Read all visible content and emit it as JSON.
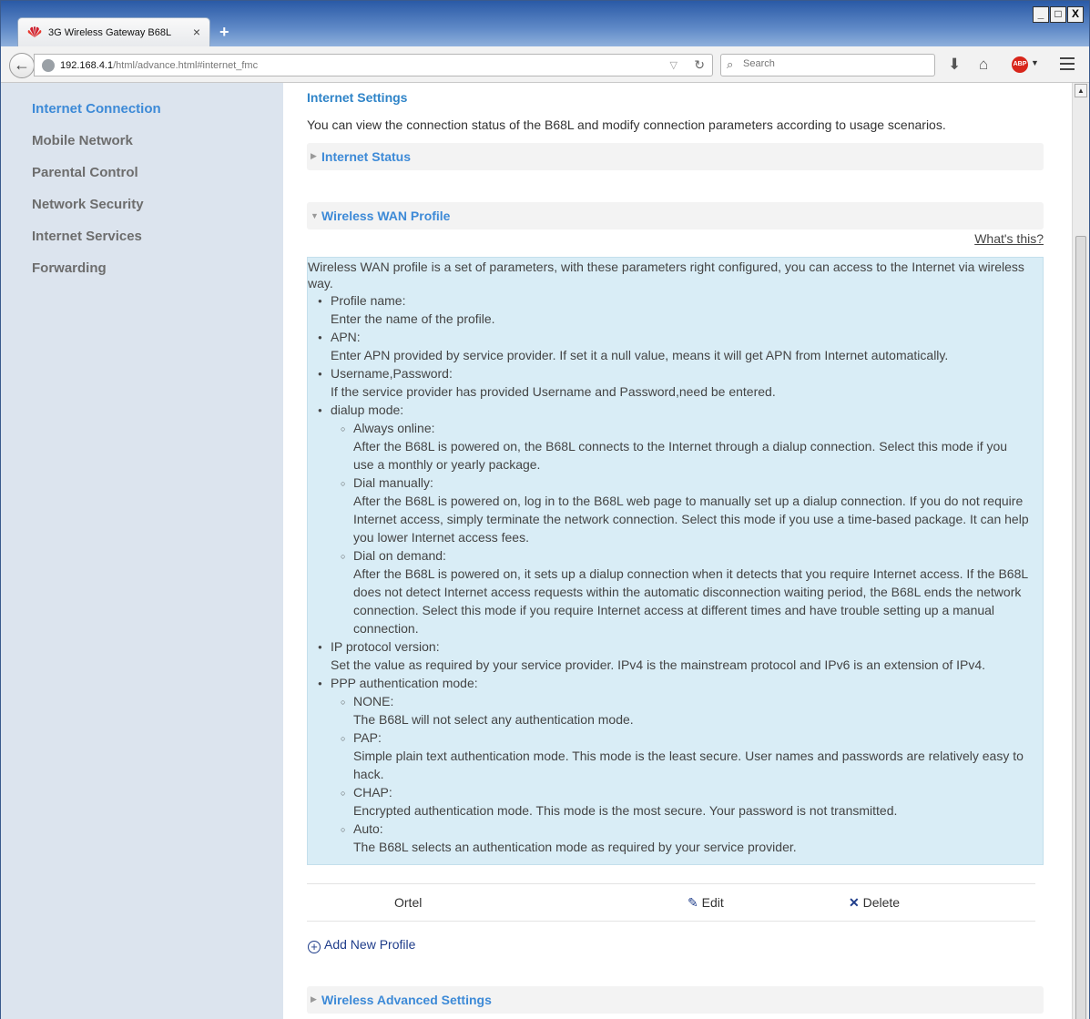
{
  "browser": {
    "tab_title": "3G Wireless Gateway B68L",
    "tab_close": "×",
    "new_tab": "+",
    "url_host": "192.168.4.1",
    "url_path": "/html/advance.html#internet_fmc",
    "search_placeholder": "Search",
    "window_buttons": [
      "_",
      "□",
      "X"
    ],
    "abp_label": "ABP"
  },
  "sidebar": {
    "items": [
      {
        "label": "Internet Connection",
        "active": true
      },
      {
        "label": "Mobile Network"
      },
      {
        "label": "Parental Control"
      },
      {
        "label": "Network Security"
      },
      {
        "label": "Internet Services"
      },
      {
        "label": "Forwarding"
      }
    ]
  },
  "main": {
    "title": "Internet Settings",
    "intro": "You can view the connection status of the B68L and modify connection parameters according to usage scenarios.",
    "sections": {
      "status": "Internet Status",
      "wan_profile": "Wireless WAN Profile",
      "advanced": "Wireless Advanced Settings"
    },
    "whats_this": "What's this?",
    "help": {
      "desc": "Wireless WAN profile is a set of parameters, with these parameters right configured, you can access to the Internet via wireless way.",
      "lines": [
        {
          "lvl": 1,
          "t": "Profile name:"
        },
        {
          "lvl": 1.5,
          "t": "Enter the name of the profile."
        },
        {
          "lvl": 1,
          "t": "APN:"
        },
        {
          "lvl": 1.5,
          "t": "Enter APN provided by service provider. If set it a null value, means it will get APN from Internet automatically."
        },
        {
          "lvl": 1,
          "t": "Username,Password:"
        },
        {
          "lvl": 1.5,
          "t": "If the service provider has provided Username and Password,need be entered."
        },
        {
          "lvl": 1,
          "t": "dialup mode:"
        },
        {
          "lvl": 2,
          "t": "Always online:"
        },
        {
          "lvl": 2.5,
          "t": "After the B68L is powered on, the B68L connects to the Internet through a dialup connection. Select this mode if you"
        },
        {
          "lvl": 2.5,
          "t": "use a monthly or yearly package."
        },
        {
          "lvl": 2,
          "t": "Dial manually:"
        },
        {
          "lvl": 2.5,
          "t": "After the B68L is powered on, log in to the B68L web page to manually set up a dialup connection. If you do not require"
        },
        {
          "lvl": 2.5,
          "t": "Internet access, simply terminate the network connection. Select this mode if you use a time-based package. It can help"
        },
        {
          "lvl": 2.5,
          "t": "you lower Internet access fees."
        },
        {
          "lvl": 2,
          "t": "Dial on demand:"
        },
        {
          "lvl": 2.5,
          "t": "After the B68L is powered on, it sets up a dialup connection when it detects that you require Internet access. If the B68L"
        },
        {
          "lvl": 2.5,
          "t": "does not detect Internet access requests within the automatic disconnection waiting period, the B68L ends the network"
        },
        {
          "lvl": 2.5,
          "t": "connection. Select this mode if you require Internet access at different times and have trouble setting up a manual"
        },
        {
          "lvl": 2.5,
          "t": "connection."
        },
        {
          "lvl": 1,
          "t": "IP protocol version:"
        },
        {
          "lvl": 1.5,
          "t": "Set the value as required by your service provider. IPv4 is the mainstream protocol and IPv6 is an extension of IPv4."
        },
        {
          "lvl": 1,
          "t": "PPP authentication mode:"
        },
        {
          "lvl": 2,
          "t": "NONE:"
        },
        {
          "lvl": 2.5,
          "t": "The B68L will not select any authentication mode."
        },
        {
          "lvl": 2,
          "t": "PAP:"
        },
        {
          "lvl": 2.5,
          "t": "Simple plain text authentication mode. This mode is the least secure. User names and passwords are relatively easy to"
        },
        {
          "lvl": 2.5,
          "t": "hack."
        },
        {
          "lvl": 2,
          "t": "CHAP:"
        },
        {
          "lvl": 2.5,
          "t": "Encrypted authentication mode. This mode is the most secure. Your password is not transmitted."
        },
        {
          "lvl": 2,
          "t": "Auto:"
        },
        {
          "lvl": 2.5,
          "t": "The B68L selects an authentication mode as required by your service provider."
        }
      ]
    },
    "profiles": [
      {
        "name": "Ortel",
        "edit": "Edit",
        "delete": "Delete"
      }
    ],
    "add_profile": "Add New Profile"
  },
  "colors": {
    "accent": "#3d8ad7",
    "sidebar_bg": "#dce4ee",
    "help_bg": "#d9edf6"
  }
}
